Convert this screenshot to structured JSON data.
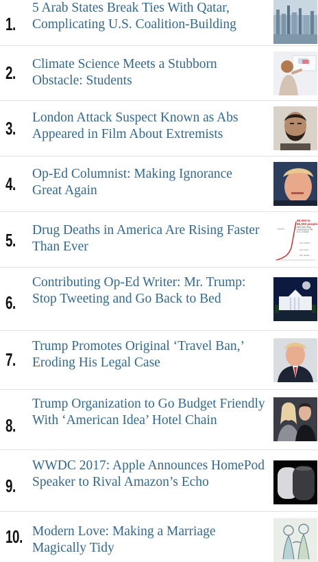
{
  "articles": [
    {
      "rank": "1.",
      "title": "5 Arab States Break Ties With Qatar, Complicating U.S. Coalition-Building",
      "thumb": "city-skyline-thumbnail"
    },
    {
      "rank": "2.",
      "title": "Climate Science Meets a Stubborn Obstacle: Students",
      "thumb": "student-at-board-thumbnail"
    },
    {
      "rank": "3.",
      "title": "London Attack Suspect Known as Abs Appeared in Film About Extremists",
      "thumb": "suspect-portrait-thumbnail"
    },
    {
      "rank": "4.",
      "title": "Op-Ed Columnist: Making Ignorance Great Again",
      "thumb": "trump-portrait-thumbnail"
    },
    {
      "rank": "5.",
      "title": "Drug Deaths in America Are Rising Faster Than Ever",
      "thumb": "drug-deaths-chart-thumbnail",
      "thumb_text": [
        "59,000 to",
        "65,000 people",
        "died from drug",
        "overdoses in the",
        "U.S. in 2016",
        "60,000",
        "Gun deaths",
        "Car crash",
        "HIV deaths"
      ]
    },
    {
      "rank": "6.",
      "title": "Contributing Op-Ed Writer: Mr. Trump: Stop Tweeting and Go Back to Bed",
      "thumb": "white-house-night-thumbnail"
    },
    {
      "rank": "7.",
      "title": "Trump Promotes Original ‘Travel Ban,’ Eroding His Legal Case",
      "thumb": "trump-suit-thumbnail"
    },
    {
      "rank": "8.",
      "title": "Trump Organization to Go Budget Friendly With ‘American Idea’ Hotel Chain",
      "thumb": "trump-family-thumbnail"
    },
    {
      "rank": "9.",
      "title": "WWDC 2017: Apple Announces HomePod Speaker to Rival Amazon’s Echo",
      "thumb": "homepod-speaker-thumbnail"
    },
    {
      "rank": "10.",
      "title": "Modern Love: Making a Marriage Magically Tidy",
      "thumb": "illustration-couple-thumbnail"
    }
  ]
}
